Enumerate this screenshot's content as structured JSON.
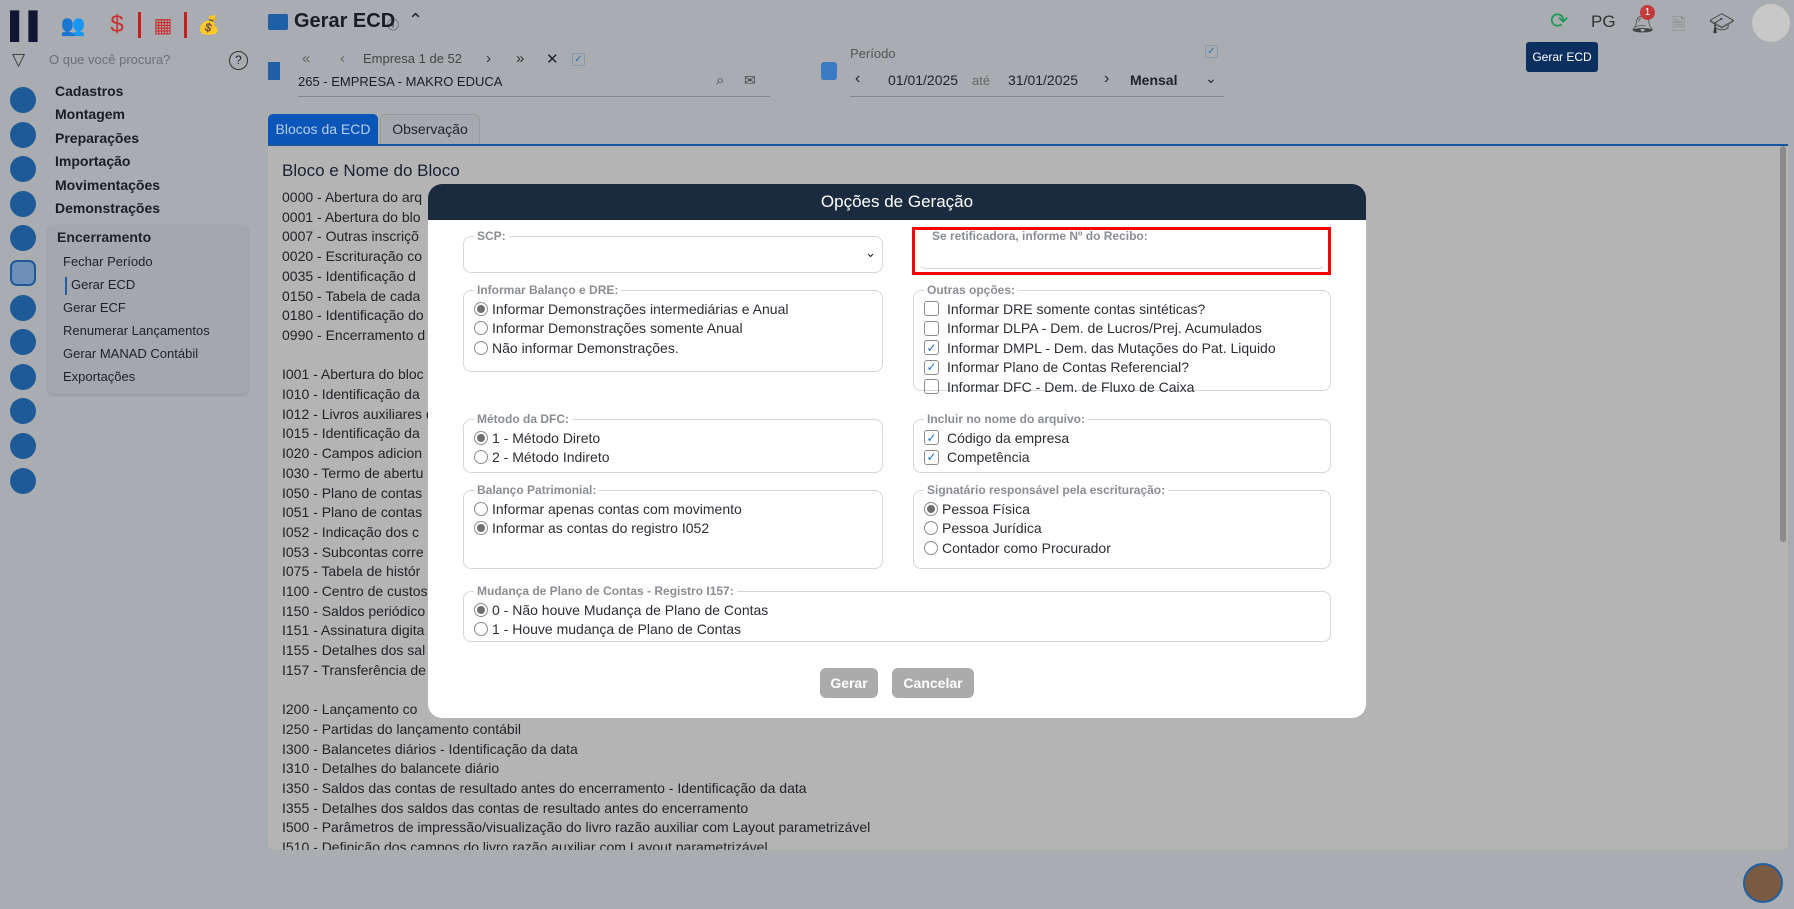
{
  "header": {
    "title": "Gerar ECD",
    "pg": "PG",
    "notif_count": "1",
    "tooltip": "Gerar ECD"
  },
  "search": {
    "placeholder": "O que você procura?"
  },
  "menu": [
    "Cadastros",
    "Montagem",
    "Preparações",
    "Importação",
    "Movimentações",
    "Demonstrações"
  ],
  "submenu": {
    "title": "Encerramento",
    "items": [
      "Fechar Período",
      "Gerar ECD",
      "Gerar ECF",
      "Renumerar Lançamentos",
      "Gerar MANAD Contábil",
      "Exportações"
    ]
  },
  "empresa": {
    "nav": "Empresa 1 de 52",
    "value": "265 - EMPRESA - MAKRO EDUCA"
  },
  "periodo": {
    "label": "Período",
    "start": "01/01/2025",
    "sep": "até",
    "end": "31/01/2025",
    "type": "Mensal"
  },
  "tabs": [
    "Blocos da ECD",
    "Observação"
  ],
  "blocks": {
    "title": "Bloco e Nome do Bloco",
    "items": [
      "0000 - Abertura do arq",
      "0001 - Abertura do blo",
      "0007 - Outras inscriçõ",
      "0020 - Escrituração co",
      "0035 - Identificação d",
      "0150 - Tabela de cada",
      "0180 - Identificação do",
      "0990 - Encerramento d",
      "",
      "I001 - Abertura do bloc",
      "I010 - Identificação da",
      "I012 - Livros auxiliares d",
      "I015 - Identificação da",
      "I020 - Campos adicion",
      "I030 - Termo de abertu",
      "I050 - Plano de contas",
      "I051 - Plano de contas",
      "I052 - Indicação dos c",
      "I053 - Subcontas corre",
      "I075 - Tabela de histór",
      "I100 - Centro de custos",
      "I150 - Saldos periódico",
      "I151 - Assinatura digita",
      "I155 - Detalhes dos sal",
      "I157 - Transferência de",
      "",
      "I200 - Lançamento co",
      "I250 - Partidas do lançamento contábil",
      "I300 - Balancetes diários - Identificação da data",
      "I310 - Detalhes do balancete diário",
      "I350 - Saldos das contas de resultado antes do encerramento - Identificação da data",
      "I355 - Detalhes dos saldos das contas de resultado antes do encerramento",
      "I500 - Parâmetros de impressão/visualização do livro razão auxiliar com Layout parametrizável",
      "I510 - Definição dos campos do livro razão auxiliar com Layout parametrizável"
    ]
  },
  "modal": {
    "title": "Opções de Geração",
    "scp": {
      "label": "SCP:",
      "value": ""
    },
    "recibo": {
      "label": "Se retificadora, informe Nº do Recibo:",
      "value": ""
    },
    "balanco_dre": {
      "label": "Informar Balanço e DRE:",
      "options": [
        "Informar Demonstrações intermediárias e Anual",
        "Informar Demonstrações somente Anual",
        "Não informar Demonstrações."
      ],
      "selected": 0
    },
    "outras": {
      "label": "Outras opções:",
      "options": [
        {
          "label": "Informar DRE somente contas sintéticas?",
          "checked": false
        },
        {
          "label": "Informar DLPA - Dem. de Lucros/Prej. Acumulados",
          "checked": false
        },
        {
          "label": "Informar DMPL - Dem. das Mutações do Pat. Liquido",
          "checked": true
        },
        {
          "label": "Informar Plano de Contas Referencial?",
          "checked": true
        },
        {
          "label": "Informar DFC - Dem. de Fluxo de Caixa",
          "checked": false
        }
      ]
    },
    "dfc": {
      "label": "Método da DFC:",
      "options": [
        "1 - Método Direto",
        "2 - Método Indireto"
      ],
      "selected": 0
    },
    "arquivo": {
      "label": "Incluir no nome do arquivo:",
      "options": [
        {
          "label": "Código da empresa",
          "checked": true
        },
        {
          "label": "Competência",
          "checked": true
        }
      ]
    },
    "patrimonial": {
      "label": "Balanço Patrimonial:",
      "options": [
        "Informar apenas contas com movimento",
        "Informar as contas do registro I052"
      ],
      "selected": 1
    },
    "signatario": {
      "label": "Signatário responsável pela escrituração:",
      "options": [
        "Pessoa Física",
        "Pessoa Jurídica",
        "Contador como Procurador"
      ],
      "selected": 0
    },
    "mudanca": {
      "label": "Mudança de Plano de Contas - Registro I157:",
      "options": [
        "0 - Não houve Mudança de Plano de Contas",
        "1 - Houve mudança de Plano de Contas"
      ],
      "selected": 0
    },
    "gerar": "Gerar",
    "cancelar": "Cancelar"
  },
  "colors": {
    "accent": "#0a56b8",
    "modal_header": "#1b2b3f",
    "highlight": "#ff0000"
  }
}
